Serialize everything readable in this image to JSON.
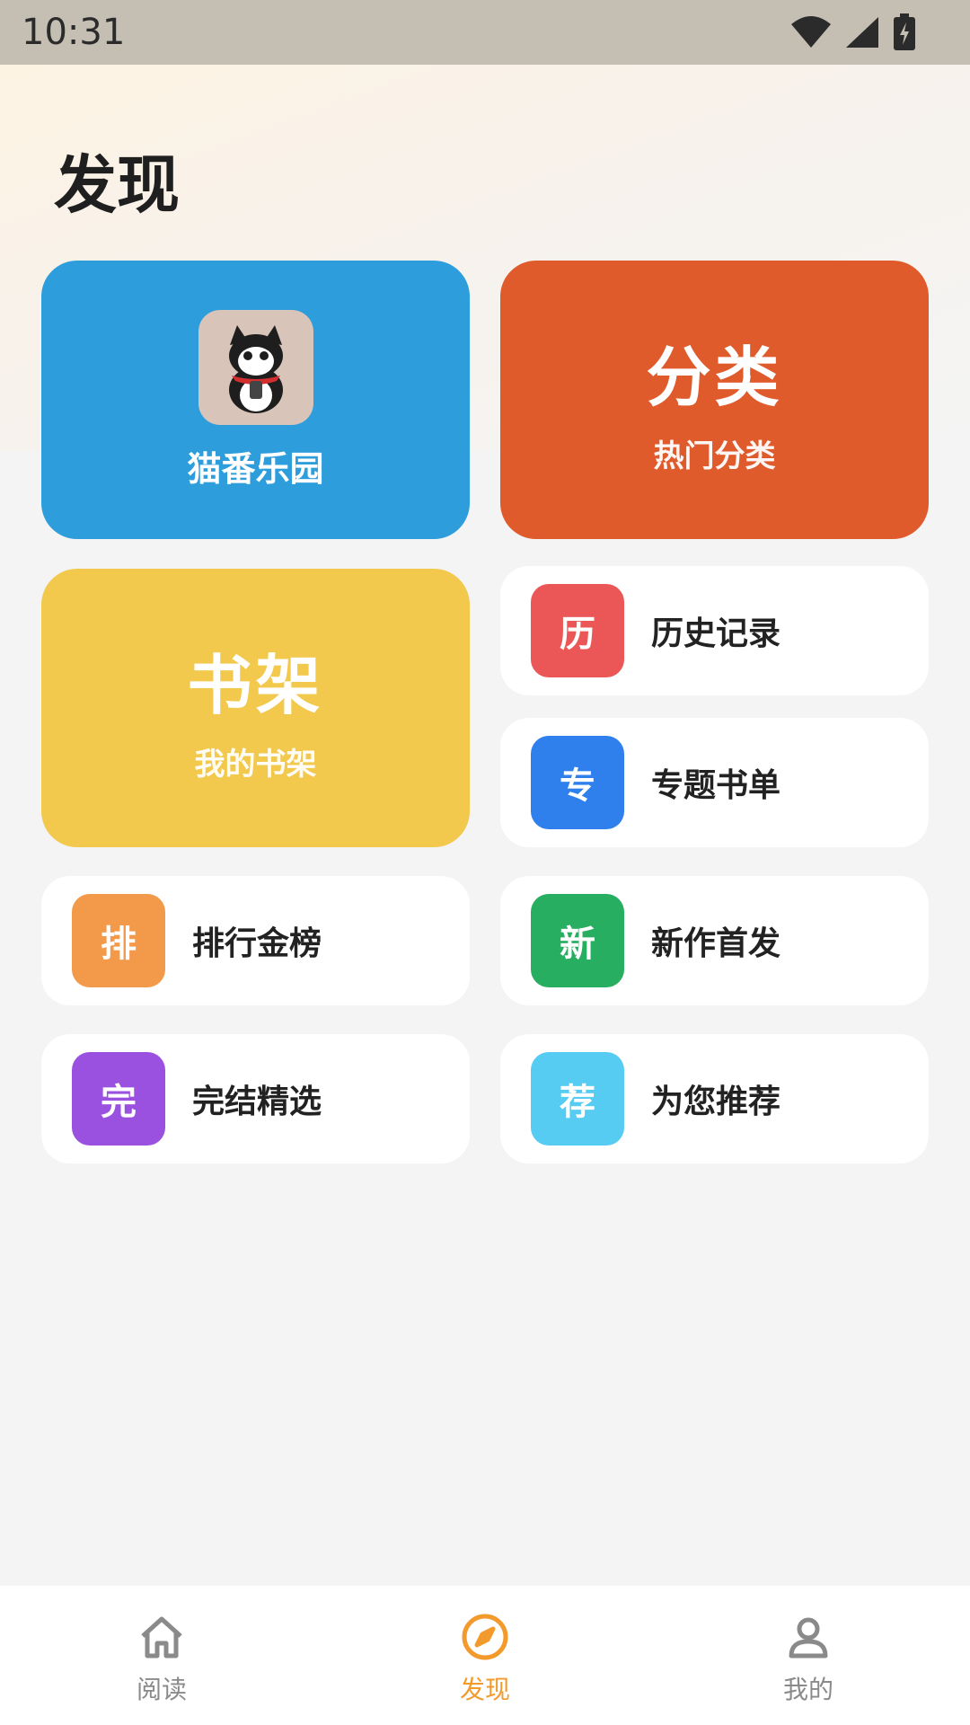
{
  "status": {
    "time": "10:31"
  },
  "page": {
    "title": "发现"
  },
  "cards": {
    "cat_park": {
      "label": "猫番乐园",
      "color": "#2d9ddc"
    },
    "category": {
      "title": "分类",
      "subtitle": "热门分类",
      "color": "#e05b2b"
    },
    "shelf": {
      "title": "书架",
      "subtitle": "我的书架",
      "color": "#f2c94c"
    }
  },
  "menu": [
    {
      "badge": "历",
      "label": "历史记录",
      "color": "#eb5757"
    },
    {
      "badge": "专",
      "label": "专题书单",
      "color": "#2f80ed"
    },
    {
      "badge": "排",
      "label": "排行金榜",
      "color": "#f2994a"
    },
    {
      "badge": "新",
      "label": "新作首发",
      "color": "#27ae60"
    },
    {
      "badge": "完",
      "label": "完结精选",
      "color": "#9b51e0"
    },
    {
      "badge": "荐",
      "label": "为您推荐",
      "color": "#56ccf2"
    }
  ],
  "nav": {
    "items": [
      {
        "label": "阅读",
        "icon": "home-icon"
      },
      {
        "label": "发现",
        "icon": "compass-icon",
        "active": true
      },
      {
        "label": "我的",
        "icon": "user-icon"
      }
    ],
    "active_color": "#f39a2d"
  }
}
